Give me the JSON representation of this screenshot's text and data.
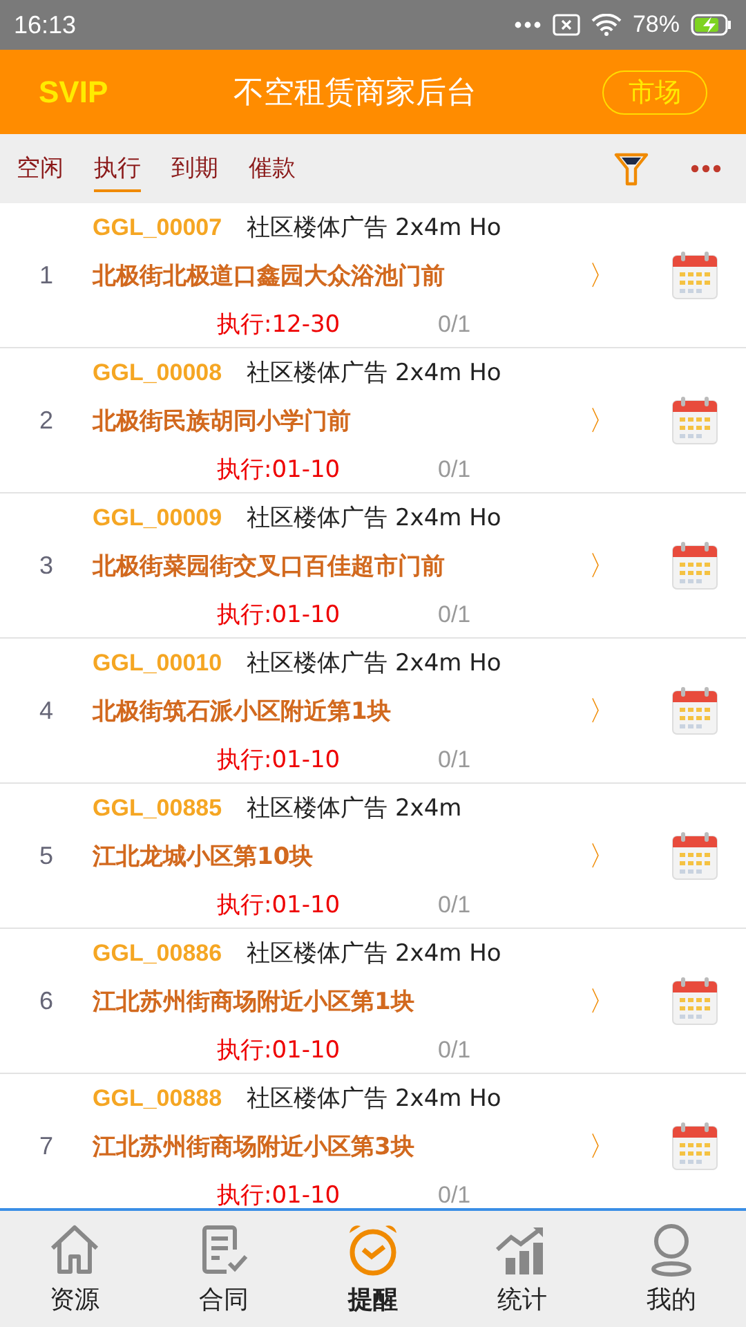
{
  "status_bar": {
    "time": "16:13",
    "battery": "78%"
  },
  "header": {
    "badge": "SVIP",
    "title": "不空租赁商家后台",
    "market_button": "市场"
  },
  "tabs": [
    {
      "label": "空闲",
      "selected": false
    },
    {
      "label": "执行",
      "selected": true
    },
    {
      "label": "到期",
      "selected": false
    },
    {
      "label": "催款",
      "selected": false
    }
  ],
  "rows": [
    {
      "index": "1",
      "code": "GGL_00007",
      "desc": "社区楼体广告 2x4m Ho",
      "address": "北极街北极道口鑫园大众浴池门前",
      "arrow": "〉",
      "exec": "执行:12-30",
      "count": "0/1"
    },
    {
      "index": "2",
      "code": "GGL_00008",
      "desc": "社区楼体广告 2x4m Ho",
      "address": "北极街民族胡同小学门前",
      "arrow": "〉",
      "exec": "执行:01-10",
      "count": "0/1"
    },
    {
      "index": "3",
      "code": "GGL_00009",
      "desc": "社区楼体广告 2x4m Ho",
      "address": "北极街菜园街交叉口百佳超市门前",
      "arrow": "〉",
      "exec": "执行:01-10",
      "count": "0/1"
    },
    {
      "index": "4",
      "code": "GGL_00010",
      "desc": "社区楼体广告 2x4m Ho",
      "address": "北极街筑石派小区附近第1块",
      "arrow": "〉",
      "exec": "执行:01-10",
      "count": "0/1"
    },
    {
      "index": "5",
      "code": "GGL_00885",
      "desc": "社区楼体广告 2x4m",
      "address": "江北龙城小区第10块",
      "arrow": "〉",
      "exec": "执行:01-10",
      "count": "0/1"
    },
    {
      "index": "6",
      "code": "GGL_00886",
      "desc": "社区楼体广告 2x4m Ho",
      "address": "江北苏州街商场附近小区第1块",
      "arrow": "〉",
      "exec": "执行:01-10",
      "count": "0/1"
    },
    {
      "index": "7",
      "code": "GGL_00888",
      "desc": "社区楼体广告 2x4m Ho",
      "address": "江北苏州街商场附近小区第3块",
      "arrow": "〉",
      "exec": "执行:01-10",
      "count": "0/1"
    }
  ],
  "nav": [
    {
      "kind": "home",
      "label": "资源",
      "selected": false
    },
    {
      "kind": "contract",
      "label": "合同",
      "selected": false
    },
    {
      "kind": "alarm",
      "label": "提醒",
      "selected": true
    },
    {
      "kind": "stats",
      "label": "统计",
      "selected": false
    },
    {
      "kind": "user",
      "label": "我的",
      "selected": false
    }
  ]
}
